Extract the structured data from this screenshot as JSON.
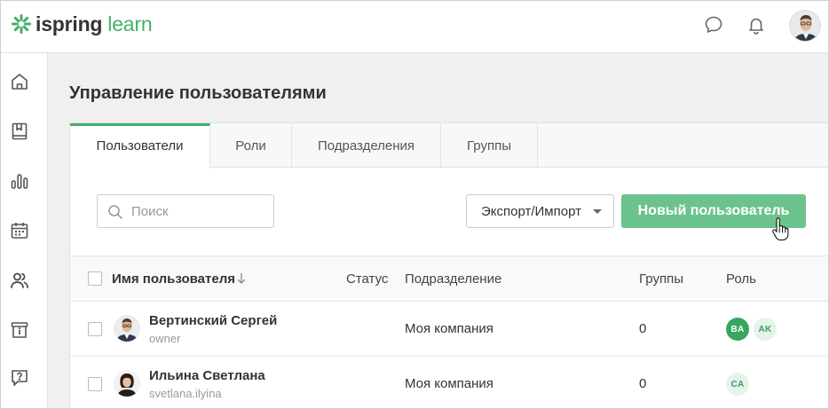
{
  "app": {
    "logo_part1": "ispring",
    "logo_part2": "learn",
    "brand_color": "#43b06b",
    "header_icons": [
      "chat-bubble-icon",
      "bell-icon"
    ],
    "profile_avatar": "user-avatar"
  },
  "sidebar": {
    "items": [
      {
        "icon": "home-icon"
      },
      {
        "icon": "book-icon"
      },
      {
        "icon": "bar-chart-icon"
      },
      {
        "icon": "calendar-icon"
      },
      {
        "icon": "users-icon",
        "active": true
      },
      {
        "icon": "info-box-icon"
      },
      {
        "icon": "help-chat-icon"
      }
    ]
  },
  "page": {
    "title": "Управление пользователями"
  },
  "tabs": [
    {
      "label": "Пользователи",
      "active": true
    },
    {
      "label": "Роли"
    },
    {
      "label": "Подразделения"
    },
    {
      "label": "Группы"
    }
  ],
  "toolbar": {
    "search_placeholder": "Поиск",
    "export_label": "Экспорт/Импорт",
    "new_user_label": "Новый пользователь",
    "new_user_color": "#6cc28d"
  },
  "table": {
    "columns": {
      "name": "Имя пользователя",
      "status": "Статус",
      "department": "Подразделение",
      "groups": "Группы",
      "role": "Роль"
    },
    "rows": [
      {
        "name": "Вертинский Сергей",
        "login": "owner",
        "status": "",
        "department": "Моя компания",
        "groups": "0",
        "roles": [
          {
            "code": "BA",
            "style": "solid"
          },
          {
            "code": "AK",
            "style": "light"
          }
        ]
      },
      {
        "name": "Ильина Светлана",
        "login": "svetlana.ilyina",
        "status": "",
        "department": "Моя компания",
        "groups": "0",
        "roles": [
          {
            "code": "CA",
            "style": "light"
          }
        ]
      }
    ]
  }
}
